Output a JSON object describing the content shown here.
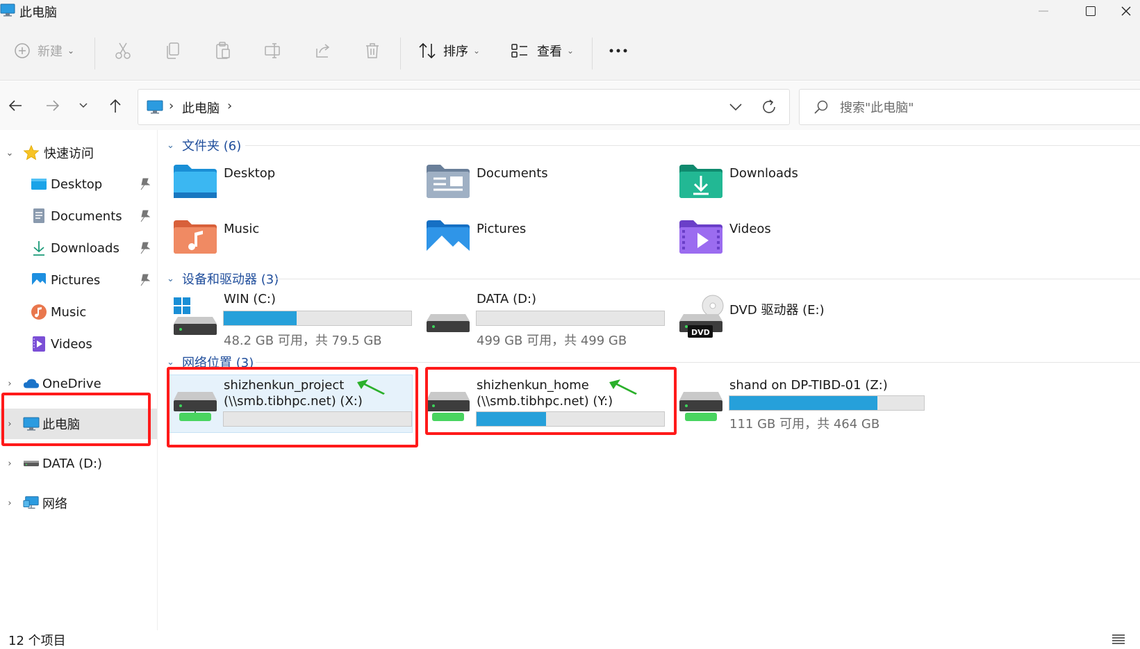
{
  "window": {
    "title": "此电脑"
  },
  "toolbar": {
    "new_label": "新建",
    "sort_label": "排序",
    "view_label": "查看",
    "more_label": "..."
  },
  "address": {
    "crumb": "此电脑",
    "search_placeholder": "搜索\"此电脑\""
  },
  "sidebar": {
    "quick_access": "快速访问",
    "items": [
      {
        "label": "Desktop"
      },
      {
        "label": "Documents"
      },
      {
        "label": "Downloads"
      },
      {
        "label": "Pictures"
      },
      {
        "label": "Music"
      },
      {
        "label": "Videos"
      }
    ],
    "onedrive": "OneDrive",
    "this_pc": "此电脑",
    "data_drive": "DATA (D:)",
    "network": "网络"
  },
  "groups": {
    "folders": "文件夹 (6)",
    "devices": "设备和驱动器 (3)",
    "network": "网络位置 (3)"
  },
  "folders": [
    {
      "label": "Desktop",
      "icon": "desktop-folder-icon"
    },
    {
      "label": "Documents",
      "icon": "documents-folder-icon"
    },
    {
      "label": "Downloads",
      "icon": "downloads-folder-icon"
    },
    {
      "label": "Music",
      "icon": "music-folder-icon"
    },
    {
      "label": "Pictures",
      "icon": "pictures-folder-icon"
    },
    {
      "label": "Videos",
      "icon": "videos-folder-icon"
    }
  ],
  "drives": [
    {
      "label": "WIN (C:)",
      "space": "48.2 GB 可用，共 79.5 GB",
      "used_fraction": 0.39
    },
    {
      "label": "DATA (D:)",
      "space": "499 GB 可用，共 499 GB",
      "used_fraction": 0.0
    },
    {
      "label": "DVD 驱动器 (E:)",
      "badge": "DVD"
    }
  ],
  "network_locations": [
    {
      "label": "shizhenkun_project",
      "path": "(\\\\smb.tibhpc.net) (X:)",
      "used_fraction": 0.0
    },
    {
      "label": "shizhenkun_home",
      "path": "(\\\\smb.tibhpc.net) (Y:)",
      "used_fraction": 0.37
    },
    {
      "label": "shand on DP-TIBD-01 (Z:)",
      "space": "111 GB 可用，共 464 GB",
      "used_fraction": 0.76
    }
  ],
  "status": {
    "count": "12 个项目"
  },
  "colors": {
    "accent": "#26a0da",
    "highlight": "#ff1a1a",
    "arrow": "#22aa22"
  }
}
